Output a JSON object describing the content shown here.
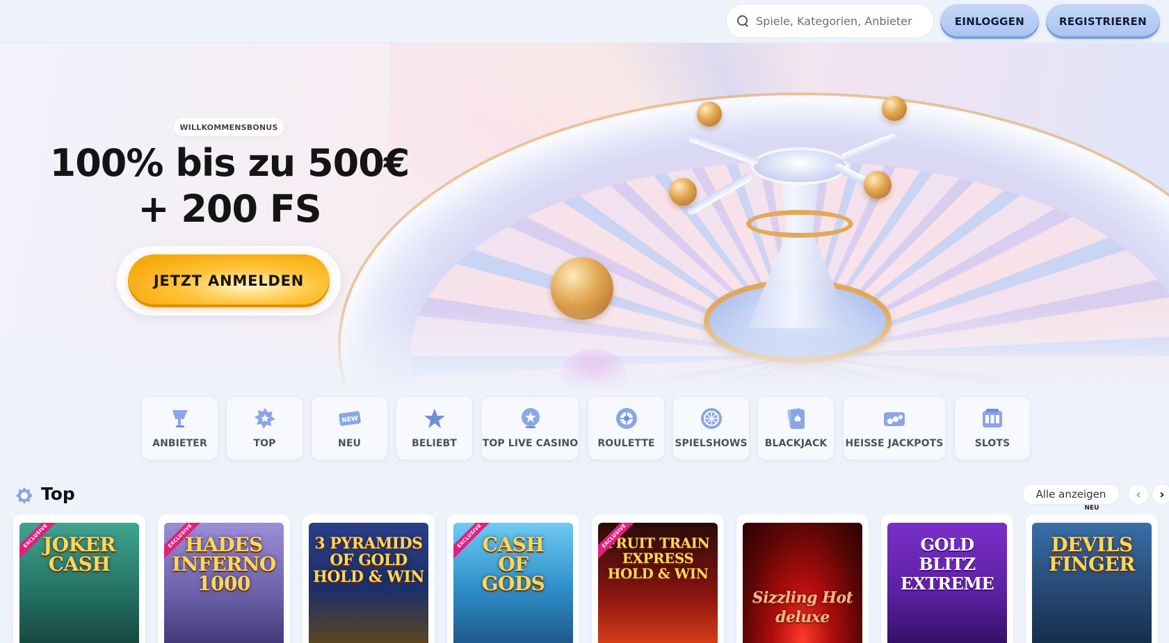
{
  "header": {
    "search_placeholder": "Spiele, Kategorien, Anbieter",
    "login_label": "EINLOGGEN",
    "register_label": "REGISTRIEREN"
  },
  "hero": {
    "badge": "WILLKOMMENSBONUS",
    "title_line1": "100% bis zu 500€",
    "title_line2": "+ 200 FS",
    "cta_label": "JETZT ANMELDEN"
  },
  "categories": [
    {
      "label": "ANBIETER",
      "icon": "trophy-icon"
    },
    {
      "label": "TOP",
      "icon": "star-badge-icon"
    },
    {
      "label": "NEU",
      "icon": "new-tag-icon"
    },
    {
      "label": "BELIEBT",
      "icon": "star-icon"
    },
    {
      "label": "TOP LIVE CASINO",
      "icon": "live-star-icon"
    },
    {
      "label": "ROULETTE",
      "icon": "roulette-icon"
    },
    {
      "label": "SPIELSHOWS",
      "icon": "wheel-icon"
    },
    {
      "label": "BLACKJACK",
      "icon": "cards-icon"
    },
    {
      "label": "HEISSE JACKPOTS",
      "icon": "coins-icon"
    },
    {
      "label": "SLOTS",
      "icon": "slot-machine-icon"
    }
  ],
  "top_section": {
    "title": "Top",
    "show_all_label": "Alle anzeigen",
    "prev_icon": "chevron-left-icon",
    "next_icon": "chevron-right-icon"
  },
  "games": [
    {
      "title": "JOKER\nCASH",
      "ribbon": "EXCLUSIVE",
      "tag": "",
      "bg": "#2a7a6e"
    },
    {
      "title": "HADES\nINFERNO\n1000",
      "ribbon": "EXCLUSIVE",
      "tag": "",
      "bg": "#6b5fa8"
    },
    {
      "title": "3 PYRAMIDS\nOF GOLD\nHOLD & WIN",
      "ribbon": "",
      "tag": "",
      "bg": "#1b2f6a"
    },
    {
      "title": "CASH\nOF\nGODS",
      "ribbon": "EXCLUSIVE",
      "tag": "",
      "bg": "#2f8ec9"
    },
    {
      "title": "FRUIT TRAIN\nEXPRESS\nHOLD & WIN",
      "ribbon": "EXCLUSIVE",
      "tag": "",
      "bg": "#8a1410"
    },
    {
      "title": "Sizzling Hot\ndeluxe",
      "ribbon": "",
      "tag": "",
      "bg": "#5a0606"
    },
    {
      "title": "GOLD BLITZ\nEXTREME",
      "ribbon": "",
      "tag": "",
      "bg": "#5b1fa0"
    },
    {
      "title": "DEVILS\nFINGER",
      "ribbon": "",
      "tag": "NEU",
      "bg": "#25466e"
    }
  ]
}
